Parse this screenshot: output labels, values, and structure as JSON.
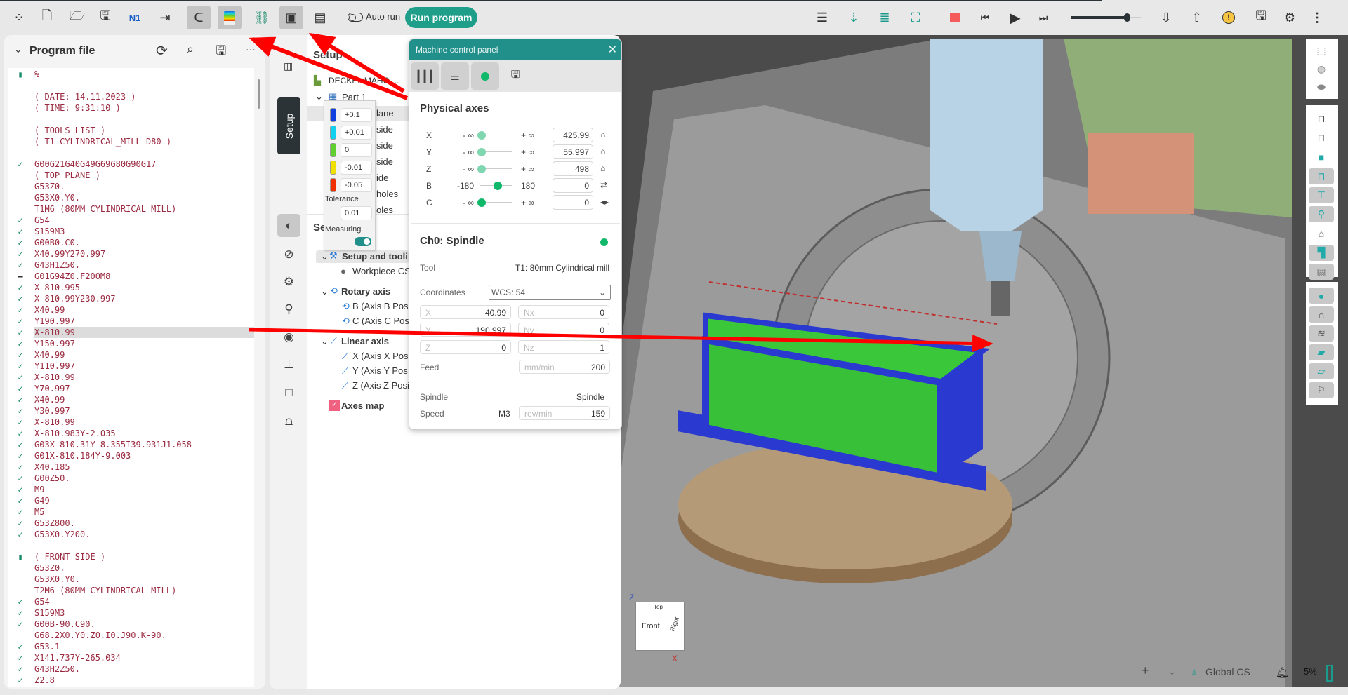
{
  "toolbar": {
    "left_icons": [
      "apps-icon",
      "new-file-icon",
      "open-folder-icon",
      "save-icon",
      "numbering-icon",
      "import-icon",
      "magnet-probe-icon",
      "tolerance-gradient-icon",
      "fixtures-icon",
      "machine-control-icon",
      "stock-panel-icon"
    ],
    "auto_run_label": "Auto run",
    "run_program_label": "Run program",
    "right_icons": [
      "list-icon",
      "list-down-icon",
      "list-colored-icon",
      "fit-view-icon",
      "stop-icon",
      "step-back-icon",
      "play-icon",
      "step-forward-icon",
      "slider",
      "down-warning-icon",
      "up-warning-icon",
      "warning-icon",
      "save-run-icon",
      "gear-icon",
      "more-icon"
    ],
    "speed_slider_value": 0.8,
    "stop_color": "#f55a5a",
    "accent": "#1f9e8a"
  },
  "program_panel": {
    "title": "Program file",
    "more": "···",
    "highlighted_line": 23,
    "lines": [
      {
        "m": "bookmark",
        "t": "%"
      },
      {
        "m": "",
        "t": ""
      },
      {
        "m": "",
        "t": "( DATE: 14.11.2023 )"
      },
      {
        "m": "",
        "t": "( TIME: 9:31:10 )"
      },
      {
        "m": "",
        "t": ""
      },
      {
        "m": "",
        "t": "( TOOLS LIST )"
      },
      {
        "m": "",
        "t": "( T1 CYLINDRICAL_MILL D80 )"
      },
      {
        "m": "",
        "t": ""
      },
      {
        "m": "check",
        "t": "G00G21G40G49G69G80G90G17"
      },
      {
        "m": "",
        "t": "( TOP PLANE )"
      },
      {
        "m": "",
        "t": "G53Z0."
      },
      {
        "m": "",
        "t": "G53X0.Y0."
      },
      {
        "m": "",
        "t": "T1M6 (80MM CYLINDRICAL MILL)"
      },
      {
        "m": "check",
        "t": "G54"
      },
      {
        "m": "check",
        "t": "S159M3"
      },
      {
        "m": "check",
        "t": "G00B0.C0."
      },
      {
        "m": "check",
        "t": "X40.99Y270.997"
      },
      {
        "m": "check",
        "t": "G43H1Z50."
      },
      {
        "m": "dash",
        "t": "G01G94Z0.F200M8"
      },
      {
        "m": "check",
        "t": "X-810.995"
      },
      {
        "m": "check",
        "t": "X-810.99Y230.997"
      },
      {
        "m": "check",
        "t": "X40.99"
      },
      {
        "m": "check",
        "t": "Y190.997"
      },
      {
        "m": "check",
        "t": "X-810.99"
      },
      {
        "m": "check",
        "t": "Y150.997"
      },
      {
        "m": "check",
        "t": "X40.99"
      },
      {
        "m": "check",
        "t": "Y110.997"
      },
      {
        "m": "check",
        "t": "X-810.99"
      },
      {
        "m": "check",
        "t": "Y70.997"
      },
      {
        "m": "check",
        "t": "X40.99"
      },
      {
        "m": "check",
        "t": "Y30.997"
      },
      {
        "m": "check",
        "t": "X-810.99"
      },
      {
        "m": "check",
        "t": "X-810.983Y-2.035"
      },
      {
        "m": "check",
        "t": "G03X-810.31Y-8.355I39.931J1.058"
      },
      {
        "m": "check",
        "t": "G01X-810.184Y-9.003"
      },
      {
        "m": "check",
        "t": "X40.185"
      },
      {
        "m": "check",
        "t": "G00Z50."
      },
      {
        "m": "check",
        "t": "M9"
      },
      {
        "m": "check",
        "t": "G49"
      },
      {
        "m": "check",
        "t": "M5"
      },
      {
        "m": "check",
        "t": "G53Z800."
      },
      {
        "m": "check",
        "t": "G53X0.Y200."
      },
      {
        "m": "",
        "t": ""
      },
      {
        "m": "bookmark",
        "t": "( FRONT SIDE )"
      },
      {
        "m": "",
        "t": "G53Z0."
      },
      {
        "m": "",
        "t": "G53X0.Y0."
      },
      {
        "m": "",
        "t": "T2M6 (80MM CYLINDRICAL MILL)"
      },
      {
        "m": "check",
        "t": "G54"
      },
      {
        "m": "check",
        "t": "S159M3"
      },
      {
        "m": "check",
        "t": "G00B-90.C90."
      },
      {
        "m": "",
        "t": "G68.2X0.Y0.Z0.I0.J90.K-90."
      },
      {
        "m": "check",
        "t": "G53.1"
      },
      {
        "m": "check",
        "t": "X141.737Y-265.034"
      },
      {
        "m": "check",
        "t": "G43H2Z50."
      },
      {
        "m": "check",
        "t": "Z2.8"
      }
    ]
  },
  "setup_panel": {
    "tab_label": "Setup",
    "header": "Setup",
    "machine": "DECKEL MAHO ...",
    "part": "Part 1",
    "operations": [
      "lane",
      "side",
      "side",
      "side",
      "ide",
      "holes",
      "oles"
    ],
    "section_header": "Se",
    "setup_and_tooling": "Setup and tooli",
    "workpiece_cs": "Workpiece CS",
    "rotary_axis": "Rotary axis",
    "rotary_items": [
      "B (Axis B Pos",
      "C (Axis C Pos"
    ],
    "linear_axis": "Linear axis",
    "linear_items": [
      "X (Axis X Posi",
      "Y (Axis Y Pos",
      "Z (Axis Z Posi"
    ],
    "axes_map": "Axes map"
  },
  "tolerance_popup": {
    "levels": [
      {
        "value": "+0.1",
        "color": "#1040e0"
      },
      {
        "value": "+0.01",
        "color": "#10d0f0"
      },
      {
        "value": "0",
        "color": "#60d030"
      },
      {
        "value": "-0.01",
        "color": "#f0e000"
      },
      {
        "value": "-0.05",
        "color": "#f03000"
      }
    ],
    "tolerance_label": "Tolerance",
    "tolerance_value": "0.01",
    "measuring_label": "Measuring",
    "measuring_on": true
  },
  "machine_control_panel": {
    "title": "Machine control panel",
    "physical_axes_title": "Physical axes",
    "axes": [
      {
        "name": "X",
        "min": "- ∞",
        "max": "+ ∞",
        "value": "425.99",
        "icon": "home-icon",
        "pos": 0.0
      },
      {
        "name": "Y",
        "min": "- ∞",
        "max": "+ ∞",
        "value": "55.997",
        "icon": "home-icon",
        "pos": 0.0
      },
      {
        "name": "Z",
        "min": "- ∞",
        "max": "+ ∞",
        "value": "498",
        "icon": "home-icon",
        "pos": 0.0
      },
      {
        "name": "B",
        "min": "-180",
        "max": "180",
        "value": "0",
        "icon": "swap-icon",
        "pos": 0.5
      },
      {
        "name": "C",
        "min": "- ∞",
        "max": "+ ∞",
        "value": "0",
        "icon": "arrows-left-right-icon",
        "pos": 0.0
      }
    ],
    "channel_title": "Ch0: Spindle",
    "tool_label": "Tool",
    "tool_value": "T1: 80mm Cylindrical mill",
    "coordinates_label": "Coordinates",
    "coordinates_value": "WCS: 54",
    "fields": {
      "x": {
        "label": "X",
        "value": "40.99"
      },
      "y": {
        "label": "Y",
        "value": "190.997"
      },
      "z": {
        "label": "Z",
        "value": "0"
      },
      "nx": {
        "label": "Nx",
        "value": "0"
      },
      "ny": {
        "label": "Ny",
        "value": "0"
      },
      "nz": {
        "label": "Nz",
        "value": "1"
      }
    },
    "feed_label": "Feed",
    "feed_unit": "mm/min",
    "feed_value": "200",
    "spindle_label": "Spindle",
    "spindle_value": "Spindle",
    "speed_label": "Speed",
    "speed_mode": "M3",
    "speed_unit": "rev/min",
    "speed_value": "159"
  },
  "viewport": {
    "view_cube": {
      "top": "Top",
      "front": "Front",
      "right": "Right",
      "axis_z": "Z",
      "axis_x": "X"
    },
    "status": {
      "plus": "+",
      "cs_label": "Global CS",
      "progress": "5%"
    }
  }
}
